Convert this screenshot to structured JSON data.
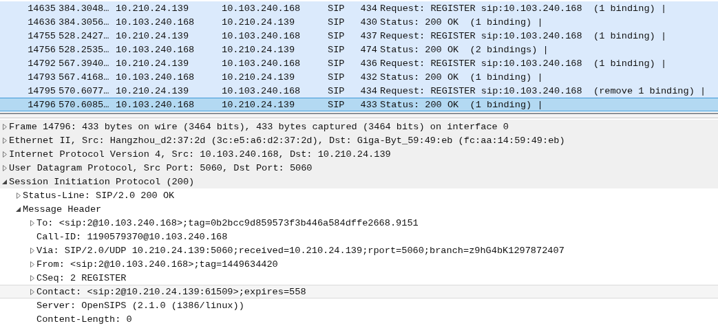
{
  "packet_list": {
    "rows": [
      {
        "no": "14635",
        "time": "384.3048…",
        "source": "10.210.24.139",
        "destination": "10.103.240.168",
        "protocol": "SIP",
        "length": "434",
        "info": "Request: REGISTER sip:10.103.240.168  (1 binding) |",
        "selected": false
      },
      {
        "no": "14636",
        "time": "384.3056…",
        "source": "10.103.240.168",
        "destination": "10.210.24.139",
        "protocol": "SIP",
        "length": "430",
        "info": "Status: 200 OK  (1 binding) |",
        "selected": false
      },
      {
        "no": "14755",
        "time": "528.2427…",
        "source": "10.210.24.139",
        "destination": "10.103.240.168",
        "protocol": "SIP",
        "length": "437",
        "info": "Request: REGISTER sip:10.103.240.168  (1 binding) |",
        "selected": false
      },
      {
        "no": "14756",
        "time": "528.2535…",
        "source": "10.103.240.168",
        "destination": "10.210.24.139",
        "protocol": "SIP",
        "length": "474",
        "info": "Status: 200 OK  (2 bindings) |",
        "selected": false
      },
      {
        "no": "14792",
        "time": "567.3940…",
        "source": "10.210.24.139",
        "destination": "10.103.240.168",
        "protocol": "SIP",
        "length": "436",
        "info": "Request: REGISTER sip:10.103.240.168  (1 binding) |",
        "selected": false
      },
      {
        "no": "14793",
        "time": "567.4168…",
        "source": "10.103.240.168",
        "destination": "10.210.24.139",
        "protocol": "SIP",
        "length": "432",
        "info": "Status: 200 OK  (1 binding) |",
        "selected": false
      },
      {
        "no": "14795",
        "time": "570.6077…",
        "source": "10.210.24.139",
        "destination": "10.103.240.168",
        "protocol": "SIP",
        "length": "434",
        "info": "Request: REGISTER sip:10.103.240.168  (remove 1 binding) |",
        "selected": false
      },
      {
        "no": "14796",
        "time": "570.6085…",
        "source": "10.103.240.168",
        "destination": "10.210.24.139",
        "protocol": "SIP",
        "length": "433",
        "info": "Status: 200 OK  (1 binding) |",
        "selected": true
      }
    ]
  },
  "detail_tree": {
    "items": [
      {
        "text": "Frame 14796: 433 bytes on wire (3464 bits), 433 bytes captured (3464 bits) on interface 0",
        "kind": "branch",
        "expanded": false,
        "selected": false
      },
      {
        "text": "Ethernet II, Src: Hangzhou_d2:37:2d (3c:e5:a6:d2:37:2d), Dst: Giga-Byt_59:49:eb (fc:aa:14:59:49:eb)",
        "kind": "branch",
        "expanded": false,
        "selected": false
      },
      {
        "text": "Internet Protocol Version 4, Src: 10.103.240.168, Dst: 10.210.24.139",
        "kind": "branch",
        "expanded": false,
        "selected": false
      },
      {
        "text": "User Datagram Protocol, Src Port: 5060, Dst Port: 5060",
        "kind": "branch",
        "expanded": false,
        "selected": false
      },
      {
        "text": "Session Initiation Protocol (200)",
        "kind": "branch",
        "expanded": true,
        "selected": false,
        "children": [
          {
            "text": "Status-Line: SIP/2.0 200 OK",
            "kind": "branch",
            "expanded": false,
            "selected": false
          },
          {
            "text": "Message Header",
            "kind": "branch",
            "expanded": true,
            "selected": false,
            "children": [
              {
                "text": "To: <sip:2@10.103.240.168>;tag=0b2bcc9d859573f3b446a584dffe2668.9151",
                "kind": "branch",
                "expanded": false,
                "selected": false
              },
              {
                "text": "Call-ID: 1190579370@10.103.240.168",
                "kind": "leaf",
                "selected": false
              },
              {
                "text": "Via: SIP/2.0/UDP 10.210.24.139:5060;received=10.210.24.139;rport=5060;branch=z9hG4bK1297872407",
                "kind": "branch",
                "expanded": false,
                "selected": false
              },
              {
                "text": "From: <sip:2@10.103.240.168>;tag=1449634420",
                "kind": "branch",
                "expanded": false,
                "selected": false
              },
              {
                "text": "CSeq: 2 REGISTER",
                "kind": "branch",
                "expanded": false,
                "selected": false
              },
              {
                "text": "Contact: <sip:2@10.210.24.139:61509>;expires=558",
                "kind": "branch",
                "expanded": false,
                "selected": true
              },
              {
                "text": "Server: OpenSIPS (2.1.0 (i386/linux))",
                "kind": "leaf",
                "selected": false
              },
              {
                "text": "Content-Length: 0",
                "kind": "leaf",
                "selected": false
              }
            ]
          }
        ]
      }
    ]
  }
}
